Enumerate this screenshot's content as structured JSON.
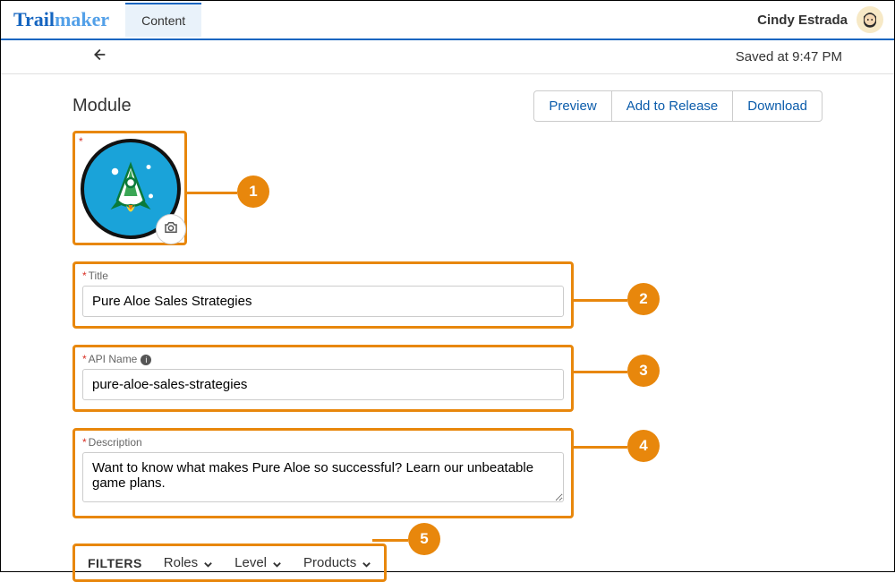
{
  "header": {
    "logo_part1": "Trail",
    "logo_part2": "maker",
    "tab": "Content",
    "username": "Cindy Estrada"
  },
  "subbar": {
    "saved_text": "Saved at 9:47 PM"
  },
  "page": {
    "heading": "Module",
    "buttons": {
      "preview": "Preview",
      "add_to_release": "Add to Release",
      "download": "Download"
    }
  },
  "fields": {
    "title_label": "Title",
    "title_value": "Pure Aloe Sales Strategies",
    "api_label": "API Name",
    "api_value": "pure-aloe-sales-strategies",
    "desc_label": "Description",
    "desc_value": "Want to know what makes Pure Aloe so successful? Learn our unbeatable game plans."
  },
  "filters": {
    "label": "FILTERS",
    "roles": "Roles",
    "level": "Level",
    "products": "Products"
  },
  "callouts": {
    "c1": "1",
    "c2": "2",
    "c3": "3",
    "c4": "4",
    "c5": "5"
  }
}
